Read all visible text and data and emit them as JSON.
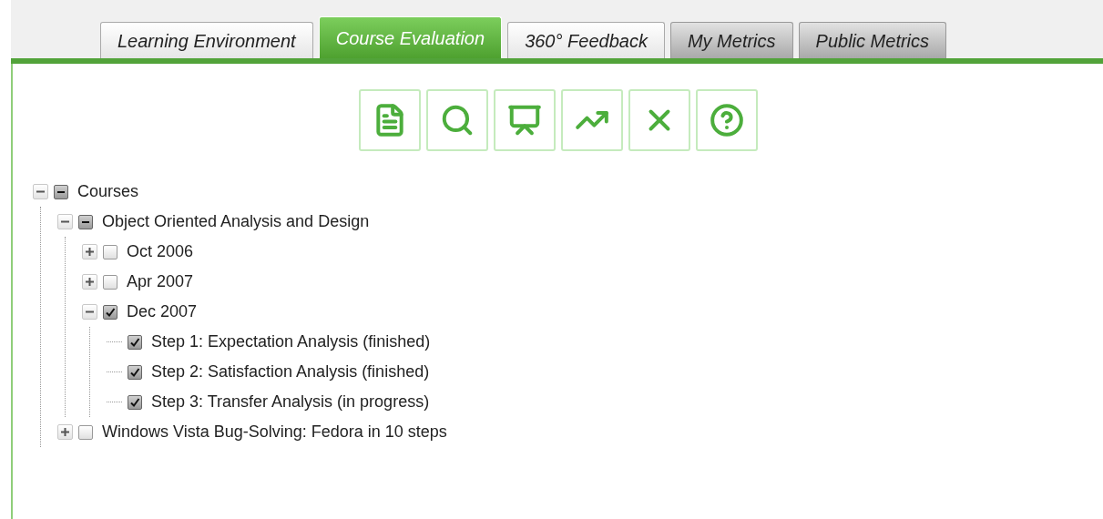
{
  "tabs": [
    {
      "label": "Learning Environment",
      "selected": false,
      "kind": "light"
    },
    {
      "label": "Course Evaluation",
      "selected": true,
      "kind": "light"
    },
    {
      "label": "360° Feedback",
      "selected": false,
      "kind": "light"
    },
    {
      "label": "My Metrics",
      "selected": false,
      "kind": "dark"
    },
    {
      "label": "Public Metrics",
      "selected": false,
      "kind": "dark"
    }
  ],
  "tree": [
    {
      "label": "Courses",
      "kind": "branch",
      "expanded": true,
      "checked": true,
      "partial": true,
      "children": [
        {
          "label": "Object Oriented Analysis and Design",
          "kind": "branch",
          "expanded": true,
          "checked": true,
          "partial": true,
          "children": [
            {
              "label": "Oct 2006",
              "kind": "branch",
              "expanded": false,
              "checked": false,
              "partial": false
            },
            {
              "label": "Apr 2007",
              "kind": "branch",
              "expanded": false,
              "checked": false,
              "partial": false
            },
            {
              "label": "Dec 2007",
              "kind": "branch",
              "expanded": true,
              "checked": true,
              "partial": false,
              "children": [
                {
                  "label": "Step 1: Expectation Analysis (finished)",
                  "kind": "leaf",
                  "checked": true,
                  "partial": false
                },
                {
                  "label": "Step 2: Satisfaction Analysis (finished)",
                  "kind": "leaf",
                  "checked": true,
                  "partial": false
                },
                {
                  "label": "Step 3: Transfer Analysis (in progress)",
                  "kind": "leaf",
                  "checked": true,
                  "partial": false
                }
              ]
            }
          ]
        },
        {
          "label": "Windows Vista Bug-Solving: Fedora in 10 steps",
          "kind": "branch",
          "expanded": false,
          "checked": false,
          "partial": false
        }
      ]
    }
  ]
}
